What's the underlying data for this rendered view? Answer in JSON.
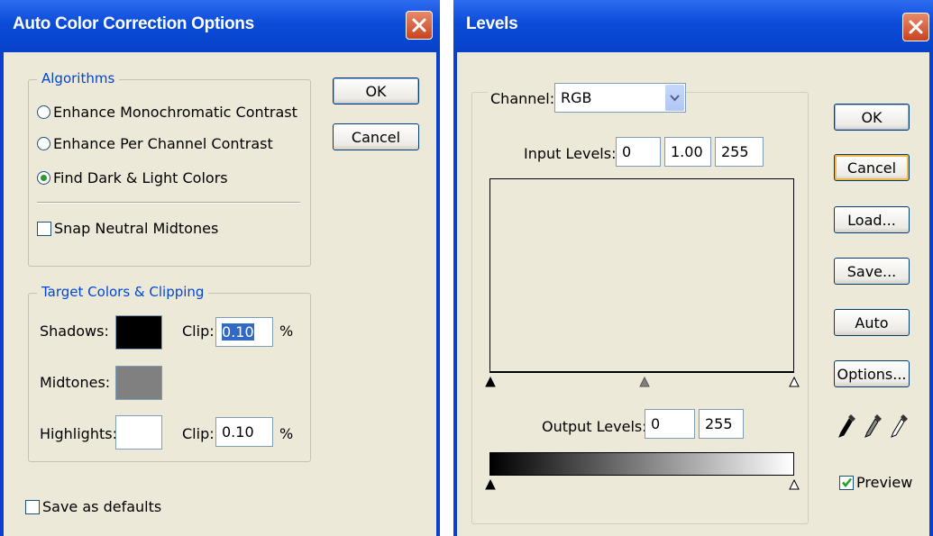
{
  "auto_color": {
    "title": "Auto Color Correction Options",
    "algorithms": {
      "legend": "Algorithms",
      "options": [
        {
          "label": "Enhance Monochromatic Contrast",
          "selected": false
        },
        {
          "label": "Enhance Per Channel Contrast",
          "selected": false
        },
        {
          "label": "Find Dark & Light Colors",
          "selected": true
        }
      ],
      "snap_label": "Snap Neutral Midtones",
      "snap_checked": false
    },
    "target": {
      "legend": "Target Colors & Clipping",
      "shadows_label": "Shadows:",
      "midtones_label": "Midtones:",
      "highlights_label": "Highlights:",
      "clip_label": "Clip:",
      "shadows_clip_first": "0",
      "shadows_clip_rest": ".10",
      "highlights_clip": "0.10",
      "percent": "%",
      "colors": {
        "shadows": "#000000",
        "midtones": "#808080",
        "highlights": "#ffffff"
      }
    },
    "save_defaults_label": "Save as defaults",
    "ok_label": "OK",
    "cancel_label": "Cancel"
  },
  "levels": {
    "title": "Levels",
    "channel_label": "Channel:",
    "channel_value": "RGB",
    "input_label": "Input Levels:",
    "input_values": [
      "0",
      "1.00",
      "255"
    ],
    "output_label": "Output Levels:",
    "output_values": [
      "0",
      "255"
    ],
    "buttons": {
      "ok": "OK",
      "cancel": "Cancel",
      "load": "Load...",
      "save": "Save...",
      "auto": "Auto",
      "options": "Options..."
    },
    "eyedroppers": [
      "black-eyedropper-icon",
      "gray-eyedropper-icon",
      "white-eyedropper-icon"
    ],
    "preview_label": "Preview",
    "preview_checked": true
  },
  "colors": {
    "titlebar": "#0a4bd8",
    "dialog_bg": "#ece9d8",
    "group_label": "#0046d5",
    "close": "#c8431f"
  }
}
